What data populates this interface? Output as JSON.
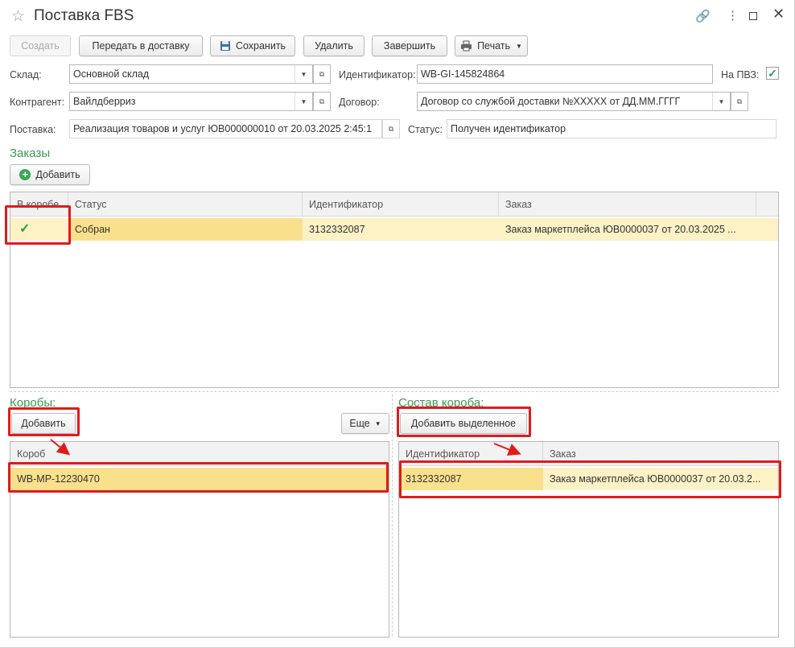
{
  "window": {
    "title": "Поставка FBS"
  },
  "toolbar": {
    "create": "Создать",
    "send": "Передать в доставку",
    "save": "Сохранить",
    "delete": "Удалить",
    "finish": "Завершить",
    "print": "Печать"
  },
  "form": {
    "warehouse_label": "Склад:",
    "warehouse_value": "Основной склад",
    "identifier_label": "Идентификатор:",
    "identifier_value": "WB-GI-145824864",
    "pvz_label": "На ПВЗ:",
    "pvz_checked": true,
    "counterparty_label": "Контрагент:",
    "counterparty_value": "Вайлдберриз",
    "contract_label": "Договор:",
    "contract_value": "Договор со службой доставки №XXXXX от ДД.ММ.ГГГГ",
    "supply_label": "Поставка:",
    "supply_value": "Реализация товаров и услуг ЮВ000000010 от 20.03.2025 2:45:1",
    "status_label": "Статус:",
    "status_value": "Получен идентификатор"
  },
  "orders": {
    "section_title": "Заказы",
    "add_button": "Добавить",
    "columns": [
      "В коробе",
      "Статус",
      "Идентификатор",
      "Заказ"
    ],
    "rows": [
      {
        "in_box": "✓",
        "status": "Собран",
        "identifier": "3132332087",
        "order": "Заказ маркетплейса ЮВ0000037 от 20.03.2025 ..."
      }
    ]
  },
  "boxes": {
    "section_title": "Коробы:",
    "add_button": "Добавить",
    "more_button": "Еще",
    "column": "Короб",
    "rows": [
      {
        "box": "WB-MP-12230470"
      }
    ]
  },
  "box_content": {
    "section_title": "Состав короба:",
    "add_selected_button": "Добавить выделенное",
    "columns": [
      "Идентификатор",
      "Заказ"
    ],
    "rows": [
      {
        "identifier": "3132332087",
        "order": "Заказ маркетплейса ЮВ0000037 от 20.03.2..."
      }
    ]
  },
  "colors": {
    "accent_green": "#3a9a54",
    "highlight": "#e01b1b",
    "row_selected": "#f9e08d"
  }
}
